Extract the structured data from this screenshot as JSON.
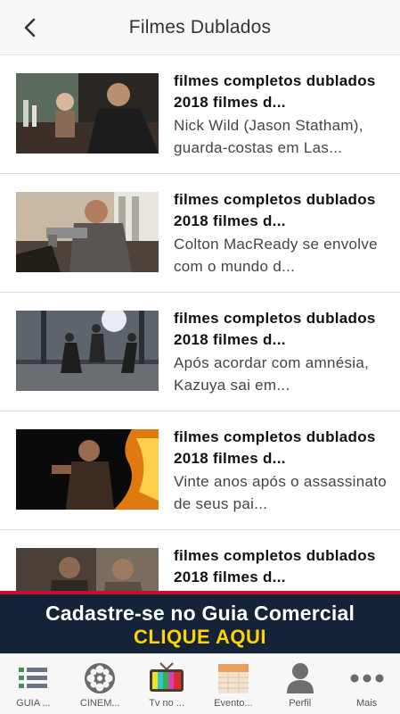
{
  "header": {
    "title": "Filmes Dublados",
    "back_icon": "chevron-left-icon"
  },
  "items": [
    {
      "title": "filmes completos dublados 2018 filmes d...",
      "description": "Nick Wild (Jason Statham), guarda-costas em Las..."
    },
    {
      "title": "filmes completos dublados 2018 filmes d...",
      "description": "Colton MacReady se envolve com o mundo d..."
    },
    {
      "title": "filmes completos dublados 2018 filmes d...",
      "description": "Após acordar com amnésia, Kazuya sai em..."
    },
    {
      "title": "filmes completos dublados 2018 filmes d...",
      "description": "Vinte anos após o assassinato de seus pai..."
    },
    {
      "title": "filmes completos dublados 2018 filmes d...",
      "description": ""
    }
  ],
  "banner": {
    "line1": "Cadastre-se no Guia Comercial",
    "line2": "CLIQUE AQUI",
    "colors": {
      "background": "#142338",
      "accent": "#c8102e",
      "highlight": "#ffd400"
    }
  },
  "tabbar": {
    "tabs": [
      {
        "label": "GUIA ...",
        "icon": "list-icon"
      },
      {
        "label": "CINEM...",
        "icon": "film-reel-icon"
      },
      {
        "label": "Tv no ...",
        "icon": "tv-icon"
      },
      {
        "label": "Evento...",
        "icon": "calendar-icon"
      },
      {
        "label": "Perfil",
        "icon": "person-icon"
      },
      {
        "label": "Mais",
        "icon": "more-dots-icon"
      }
    ]
  }
}
